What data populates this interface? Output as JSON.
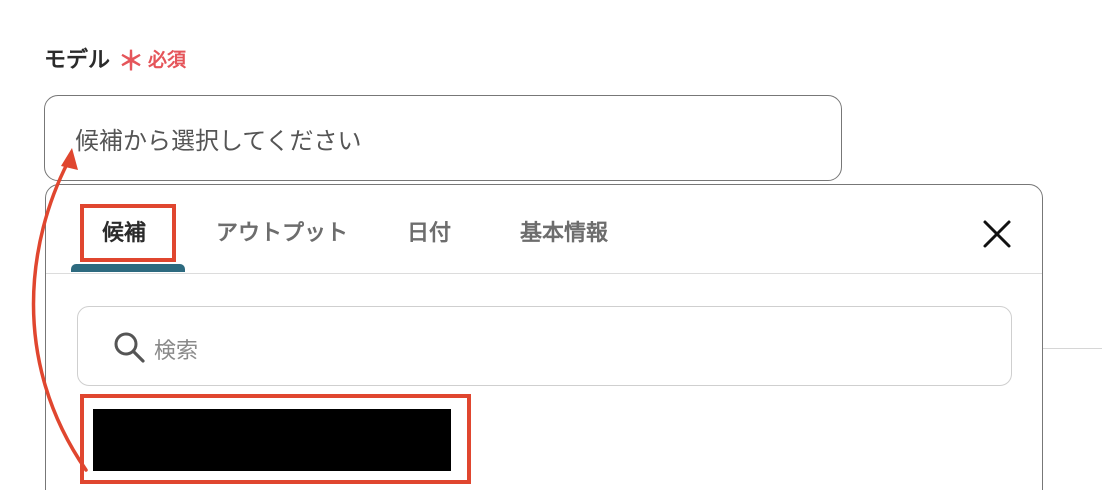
{
  "field": {
    "label": "モデル",
    "required_star": "＊",
    "required_text": "必須",
    "placeholder": "候補から選択してください"
  },
  "dropdown": {
    "tabs": [
      {
        "label": "候補",
        "active": true
      },
      {
        "label": "アウトプット",
        "active": false
      },
      {
        "label": "日付",
        "active": false
      },
      {
        "label": "基本情報",
        "active": false
      }
    ],
    "close_icon": "close-icon",
    "search": {
      "placeholder": "検索",
      "icon": "search-icon"
    },
    "items": [
      {
        "label": "",
        "redacted": true
      }
    ]
  },
  "colors": {
    "required": "#e5555a",
    "active_tab_underline": "#2d6a7f",
    "annotation": "#e0462f"
  }
}
